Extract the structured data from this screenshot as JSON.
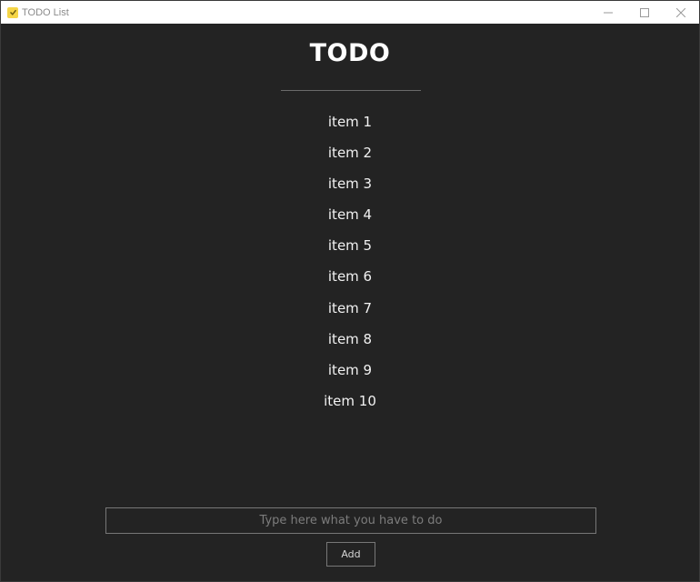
{
  "window": {
    "title": "TODO List",
    "icon": "todo-app-icon",
    "controls": [
      "minimize-icon",
      "maximize-icon",
      "close-icon"
    ]
  },
  "main": {
    "heading": "TODO",
    "items": [
      {
        "label": "item 1"
      },
      {
        "label": "item 2"
      },
      {
        "label": "item 3"
      },
      {
        "label": "item 4"
      },
      {
        "label": "item 5"
      },
      {
        "label": "item 6"
      },
      {
        "label": "item 7"
      },
      {
        "label": "item 8"
      },
      {
        "label": "item 9"
      },
      {
        "label": "item 10"
      }
    ],
    "input": {
      "value": "",
      "placeholder": "Type here what you have to do"
    },
    "add_button_label": "Add"
  },
  "colors": {
    "background": "#232323",
    "text": "#ffffff",
    "border": "#777777",
    "icon_accent": "#f5d547"
  }
}
